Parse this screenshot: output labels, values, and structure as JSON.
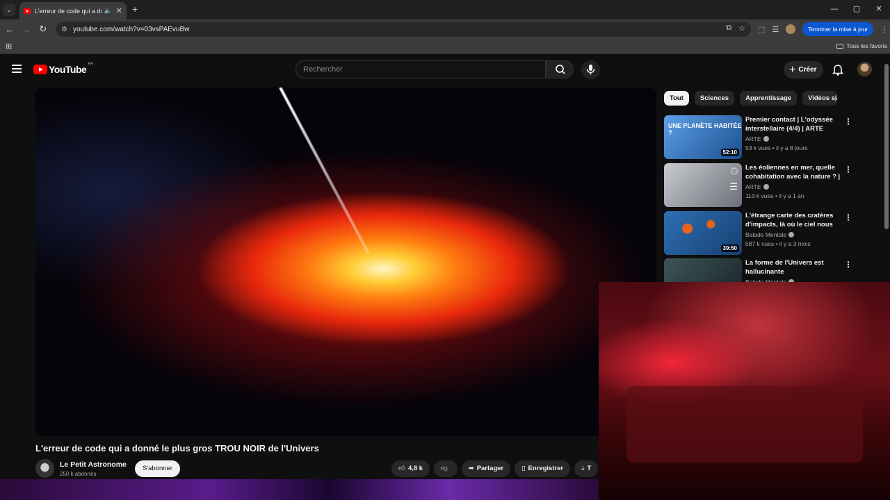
{
  "browser": {
    "tab_title": "L'erreur de code qui a donné",
    "url_site_icon": "site-settings-icon",
    "url": "youtube.com/watch?v=03vsPAEvuBw",
    "update_button": "Terminer la mise à jour",
    "bookmarks_all": "Tous les favoris"
  },
  "youtube": {
    "region": "FR",
    "logo_text": "YouTube",
    "search_placeholder": "Rechercher",
    "create_label": "Créer"
  },
  "video": {
    "title": "L'erreur de code qui a donné le plus gros TROU NOIR de l'Univers",
    "channel": "Le Petit Astronome",
    "subscribers": "250 k abonnés",
    "subscribe_label": "S'abonner",
    "likes": "4,8 k",
    "share_label": "Partager",
    "save_label": "Enregistrer",
    "download_label": "T"
  },
  "sidebar": {
    "chips": [
      "Tout",
      "Sciences",
      "Apprentissage",
      "Vidéos sim"
    ],
    "recommendations": [
      {
        "title": "Premier contact | L'odyssée interstellaire (4/4) | ARTE",
        "channel": "ARTE",
        "views": "53 k vues",
        "age": "il y a 8 jours",
        "duration": "52:10",
        "thumb_text": "UNE PLANÈTE HABITÉE ?",
        "thumb_color": "#3a7bd5"
      },
      {
        "title": "Les éoliennes en mer, quelle cohabitation avec la nature ? | ...",
        "channel": "ARTE",
        "views": "113 k vues",
        "age": "il y a 1 an",
        "duration": "",
        "thumb_text": "",
        "thumb_color": "#8a8f96"
      },
      {
        "title": "L'étrange carte des cratères d'impacts, là où le ciel nous es...",
        "channel": "Balade Mentale",
        "views": "587 k vues",
        "age": "il y a 3 mois",
        "duration": "39:50",
        "thumb_text": "",
        "thumb_color": "#1f4e8a"
      },
      {
        "title": "La forme de l'Univers est hallucinante",
        "channel": "Balade Mentale",
        "views": "",
        "age": "",
        "duration": "",
        "thumb_text": "",
        "thumb_color": "#2b3b3f"
      }
    ]
  }
}
